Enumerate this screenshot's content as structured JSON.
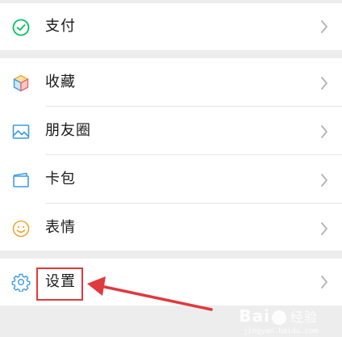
{
  "menu": {
    "payment": {
      "label": "支付",
      "icon": "payment-icon"
    },
    "favorites": {
      "label": "收藏",
      "icon": "favorites-cube-icon"
    },
    "moments": {
      "label": "朋友圈",
      "icon": "moments-image-icon"
    },
    "cards": {
      "label": "卡包",
      "icon": "card-wallet-icon"
    },
    "stickers": {
      "label": "表情",
      "icon": "smiley-icon"
    },
    "settings": {
      "label": "设置",
      "icon": "gear-icon"
    }
  },
  "colors": {
    "background": "#ededed",
    "row": "#ffffff",
    "highlight": "#e0393e",
    "payment_icon": "#07c160",
    "moments_icon": "#3b9be8",
    "cards_icon": "#3b9be8",
    "stickers_icon": "#f0a733",
    "settings_icon": "#3b9be8"
  },
  "watermark": {
    "brand": "Bai",
    "brand_suffix": "经验",
    "url": "jingyan.baidu.com"
  }
}
